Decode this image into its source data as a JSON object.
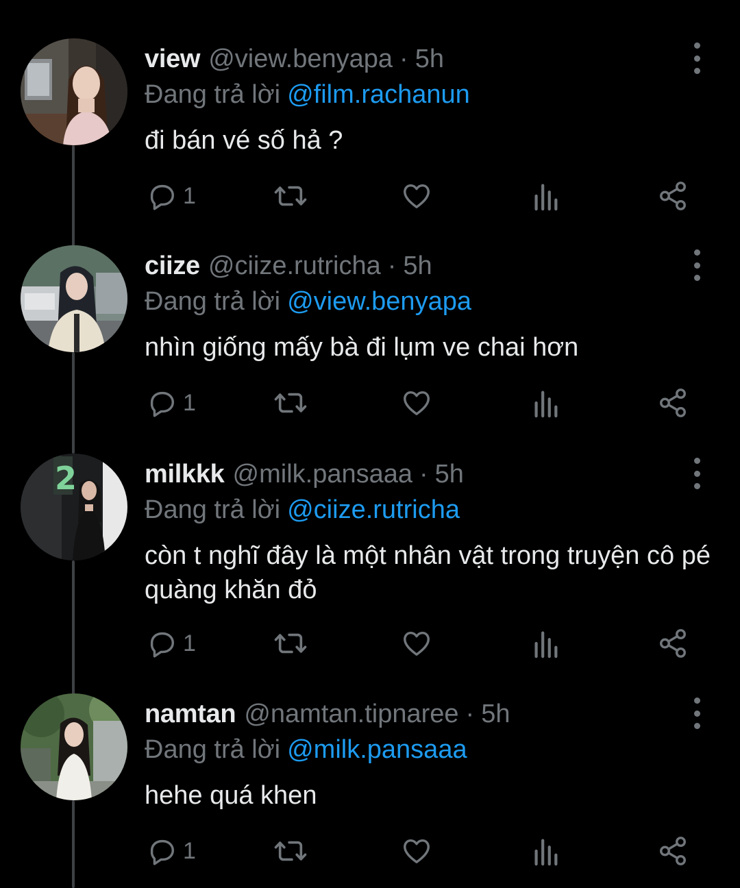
{
  "reply_prefix": "Đang trả lời",
  "separator": "·",
  "colors": {
    "background": "#000000",
    "primary_text": "#e7e9ea",
    "secondary_text": "#71767b",
    "link": "#1d9bf0",
    "thread_line": "#3e4144"
  },
  "tweets": [
    {
      "name": "view",
      "handle": "@view.benyapa",
      "time": "5h",
      "reply_to": "@film.rachanun",
      "text": "đi bán vé số hả ?",
      "reply_count": "1"
    },
    {
      "name": "ciize",
      "handle": "@ciize.rutricha",
      "time": "5h",
      "reply_to": "@view.benyapa",
      "text": "nhìn giống mấy bà đi lụm ve chai hơn",
      "reply_count": "1"
    },
    {
      "name": "milkkk",
      "handle": "@milk.pansaaa",
      "time": "5h",
      "reply_to": "@ciize.rutricha",
      "text": "còn t nghĩ đây là một nhân vật trong truyện cô pé quàng khăn đỏ",
      "reply_count": "1"
    },
    {
      "name": "namtan",
      "handle": "@namtan.tipnaree",
      "time": "5h",
      "reply_to": "@milk.pansaaa",
      "text": "hehe quá khen",
      "reply_count": "1"
    }
  ],
  "icons": {
    "reply": "reply-icon",
    "retweet": "retweet-icon",
    "like": "heart-icon",
    "views": "views-icon",
    "share": "share-icon",
    "more": "more-options-icon"
  }
}
